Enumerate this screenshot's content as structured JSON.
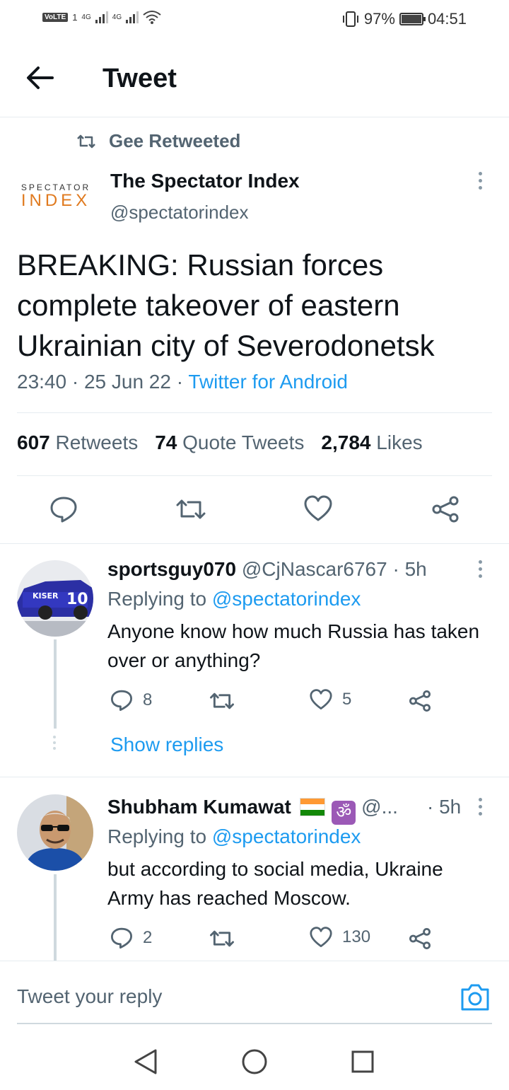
{
  "status_bar": {
    "volte": "VoLTE",
    "sim1": "1",
    "net1": "4G",
    "net2": "4G",
    "battery_pct": "97%",
    "time": "04:51",
    "icons": [
      "signal-icon",
      "wifi-icon",
      "vibrate-icon",
      "battery-icon"
    ]
  },
  "header": {
    "title": "Tweet",
    "back_icon": "arrow-left-icon"
  },
  "retweet_context": {
    "label": "Gee Retweeted"
  },
  "tweet": {
    "logo_line1": "SPECTATOR",
    "logo_line2": "INDEX",
    "author_name": "The Spectator Index",
    "author_handle": "@spectatorindex",
    "text": "BREAKING: Russian forces complete takeover of eastern Ukrainian city of Severodonetsk",
    "time": "23:40 · 25 Jun 22 · ",
    "source": "Twitter for Android",
    "stats": {
      "retweets_count": "607",
      "retweets_label": "Retweets",
      "quotes_count": "74",
      "quotes_label": "Quote Tweets",
      "likes_count": "2,784",
      "likes_label": "Likes"
    }
  },
  "replies": [
    {
      "name": "sportsguy070",
      "handle": "@CjNascar6767 · 5h",
      "replying_prefix": "Replying to ",
      "replying_to": "@spectatorindex",
      "text": "Anyone know how much Russia has taken over or anything?",
      "reply_count": "8",
      "retweet_count": "",
      "like_count": "5",
      "show_replies": "Show replies"
    },
    {
      "name": "Shubham Kumawat",
      "emoji_om": "ॐ",
      "handle": "@...",
      "time": "· 5h",
      "replying_prefix": "Replying to ",
      "replying_to": "@spectatorindex",
      "text": "but according to social media, Ukraine Army has reached Moscow.",
      "reply_count": "2",
      "retweet_count": "",
      "like_count": "130"
    }
  ],
  "reply_bar": {
    "placeholder": "Tweet your reply"
  },
  "colors": {
    "link": "#1d9bf0",
    "secondary_text": "#536471",
    "brand_orange": "#e07a1f"
  }
}
